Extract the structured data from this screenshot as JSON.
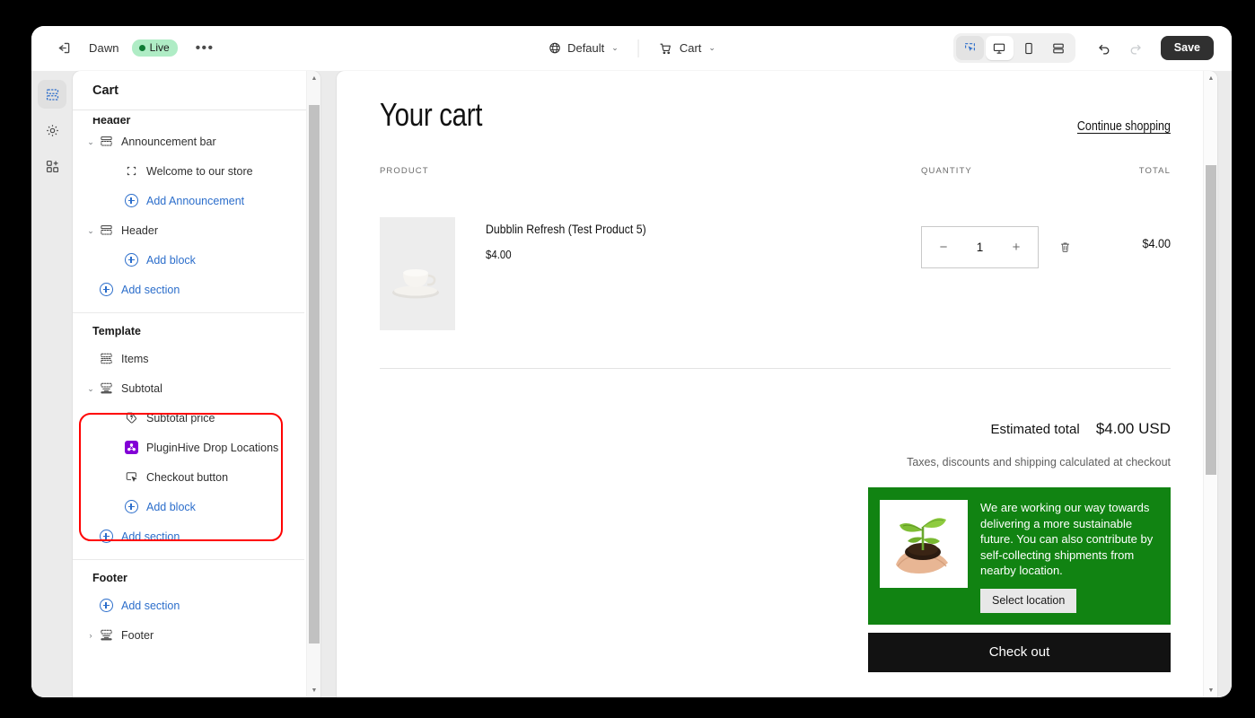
{
  "topbar": {
    "exit_icon": "exit-icon",
    "theme_name": "Dawn",
    "live_label": "Live",
    "more_label": "•••",
    "locale_label": "Default",
    "locale_icon": "globe-icon",
    "page_label": "Cart",
    "page_icon": "cart-icon",
    "caret": "⌄",
    "view_buttons": [
      {
        "name": "inspector-toggle",
        "icon": "cursor-select-icon",
        "state": "selected-blue"
      },
      {
        "name": "desktop-view",
        "icon": "desktop-icon",
        "state": "selected-white"
      },
      {
        "name": "mobile-view",
        "icon": "mobile-icon",
        "state": "idle"
      },
      {
        "name": "fullscreen-view",
        "icon": "fullwidth-icon",
        "state": "idle"
      }
    ],
    "undo_icon": "undo-icon",
    "redo_icon": "redo-icon",
    "save_label": "Save"
  },
  "rail": {
    "items": [
      {
        "name": "sidebar-rail-sections",
        "icon": "sections-icon",
        "active": true
      },
      {
        "name": "sidebar-rail-settings",
        "icon": "gear-icon",
        "active": false
      },
      {
        "name": "sidebar-rail-apps",
        "icon": "apps-icon",
        "active": false
      }
    ]
  },
  "sidebar": {
    "title": "Cart",
    "groups": [
      {
        "label": "Header",
        "clipped": true,
        "rows": [
          {
            "label": "Announcement bar",
            "icon": "section-bar-icon",
            "caret": "⌄",
            "indent": 0,
            "type": "section"
          },
          {
            "label": "Welcome to our store",
            "icon": "block-brackets-icon",
            "caret": "",
            "indent": 1,
            "type": "block"
          },
          {
            "label": "Add Announcement",
            "icon": "plus-circle-icon",
            "caret": "",
            "indent": 1,
            "type": "add"
          },
          {
            "label": "Header",
            "icon": "section-bar-icon",
            "caret": "⌄",
            "indent": 0,
            "type": "section"
          },
          {
            "label": "Add block",
            "icon": "plus-circle-icon",
            "caret": "",
            "indent": 1,
            "type": "add"
          },
          {
            "label": "Add section",
            "icon": "plus-circle-icon",
            "caret": "",
            "indent": 0,
            "type": "add"
          }
        ]
      },
      {
        "label": "Template",
        "clipped": false,
        "rows": [
          {
            "label": "Items",
            "icon": "items-icon",
            "caret": "",
            "indent": 0,
            "type": "section"
          },
          {
            "label": "Subtotal",
            "icon": "subtotal-icon",
            "caret": "⌄",
            "indent": 0,
            "type": "section"
          },
          {
            "label": "Subtotal price",
            "icon": "price-tag-icon",
            "caret": "",
            "indent": 1,
            "type": "block"
          },
          {
            "label": "PluginHive Drop Locations",
            "icon": "pluginhive-app-icon",
            "caret": "",
            "indent": 1,
            "type": "app-block"
          },
          {
            "label": "Checkout button",
            "icon": "button-cursor-icon",
            "caret": "",
            "indent": 1,
            "type": "block"
          },
          {
            "label": "Add block",
            "icon": "plus-circle-icon",
            "caret": "",
            "indent": 1,
            "type": "add"
          },
          {
            "label": "Add section",
            "icon": "plus-circle-icon",
            "caret": "",
            "indent": 0,
            "type": "add"
          }
        ]
      },
      {
        "label": "Footer",
        "clipped": false,
        "rows": [
          {
            "label": "Add section",
            "icon": "plus-circle-icon",
            "caret": "",
            "indent": 0,
            "type": "add"
          },
          {
            "label": "Footer",
            "icon": "subtotal-icon",
            "caret": "›",
            "indent": 0,
            "type": "section"
          }
        ]
      }
    ],
    "scrollbar": {
      "up_arrow": "▲",
      "down_arrow": "▼"
    }
  },
  "annotation": {
    "color": "#ff0000",
    "targets": [
      "Subtotal",
      "Subtotal price",
      "PluginHive Drop Locations",
      "Checkout button"
    ]
  },
  "preview": {
    "title": "Your cart",
    "continue_link": "Continue shopping",
    "columns": {
      "product": "PRODUCT",
      "quantity": "QUANTITY",
      "total": "TOTAL"
    },
    "items": [
      {
        "name": "Dubblin Refresh (Test Product 5)",
        "price": "$4.00",
        "quantity": "1",
        "minus": "−",
        "plus": "+",
        "remove_icon": "trash-icon",
        "line_total": "$4.00",
        "image_alt": "white-cup-and-saucer"
      }
    ],
    "estimated_total_label": "Estimated total",
    "estimated_total_value": "$4.00 USD",
    "tax_note": "Taxes, discounts and shipping calculated at checkout",
    "green_banner": {
      "background": "#118312",
      "text": "We are working our way towards delivering a more sustainable future. You can also contribute by self-collecting shipments from nearby location.",
      "button_label": "Select location",
      "image_alt": "hand-holding-plant-seedling"
    },
    "checkout_label": "Check out",
    "scrollbar": {
      "up_arrow": "▲",
      "down_arrow": "▼"
    }
  }
}
